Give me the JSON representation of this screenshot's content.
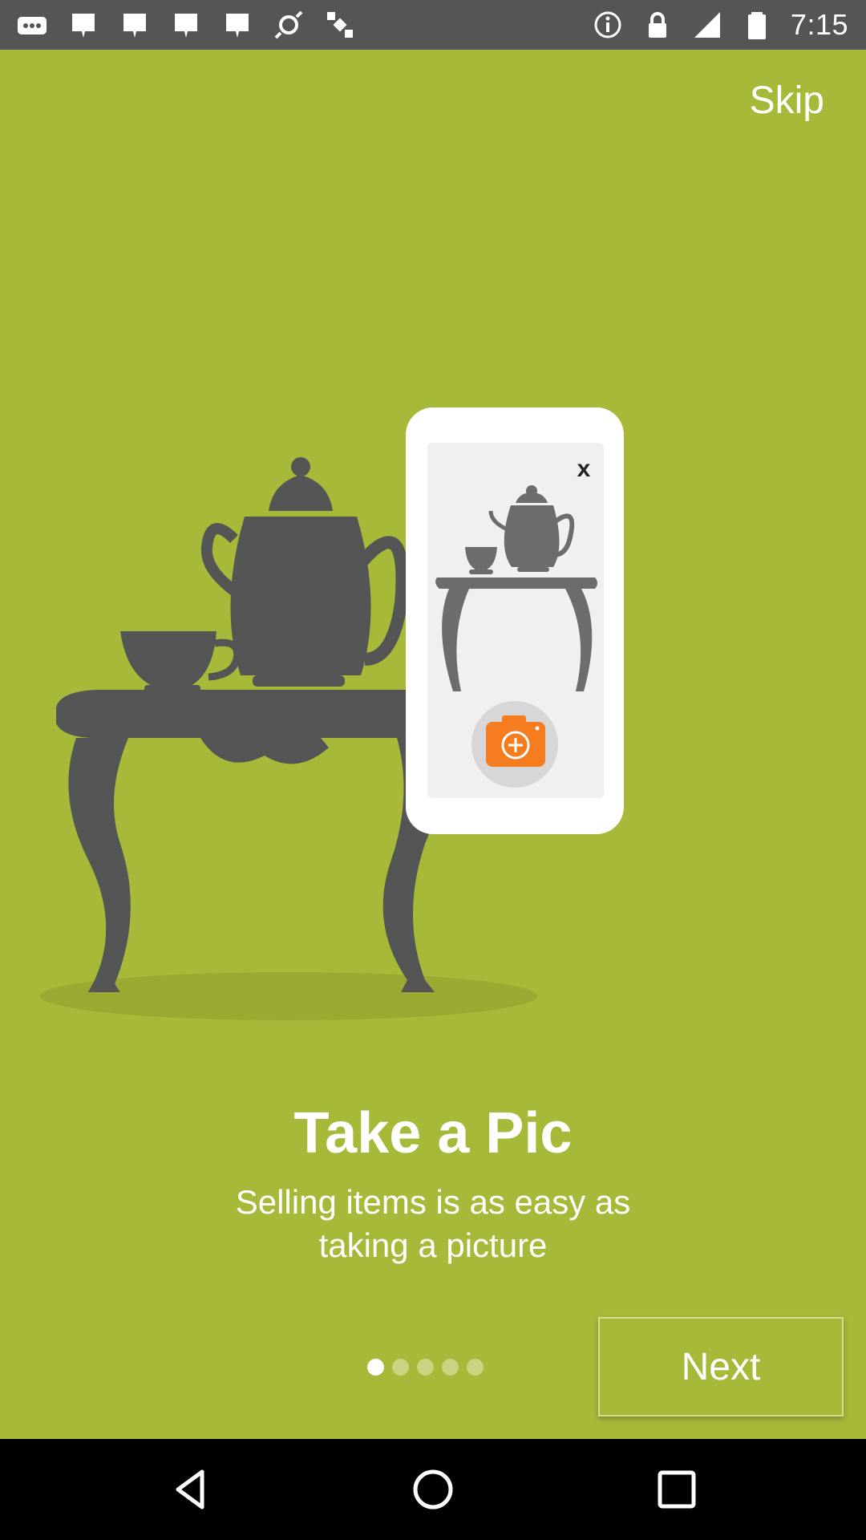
{
  "status_bar": {
    "time": "7:15",
    "left_icons": [
      "more-icon",
      "notification-icon",
      "notification-icon",
      "notification-icon",
      "notification-icon",
      "fake-gps-icon",
      "satellite-icon"
    ],
    "right_icons": [
      "info-icon",
      "lock-icon",
      "signal-icon",
      "battery-icon"
    ]
  },
  "header": {
    "skip_label": "Skip"
  },
  "illustration": {
    "phone_close_label": "x"
  },
  "content": {
    "title": "Take a Pic",
    "subtitle": "Selling items is as easy as taking a picture"
  },
  "pager": {
    "total": 5,
    "current": 1
  },
  "footer": {
    "next_label": "Next"
  },
  "colors": {
    "background": "#a8b838",
    "silhouette": "#555555",
    "camera_orange": "#f57c1f",
    "status_bar": "#555555"
  },
  "nav_bar": {
    "buttons": [
      "back-icon",
      "home-icon",
      "recents-icon"
    ]
  }
}
